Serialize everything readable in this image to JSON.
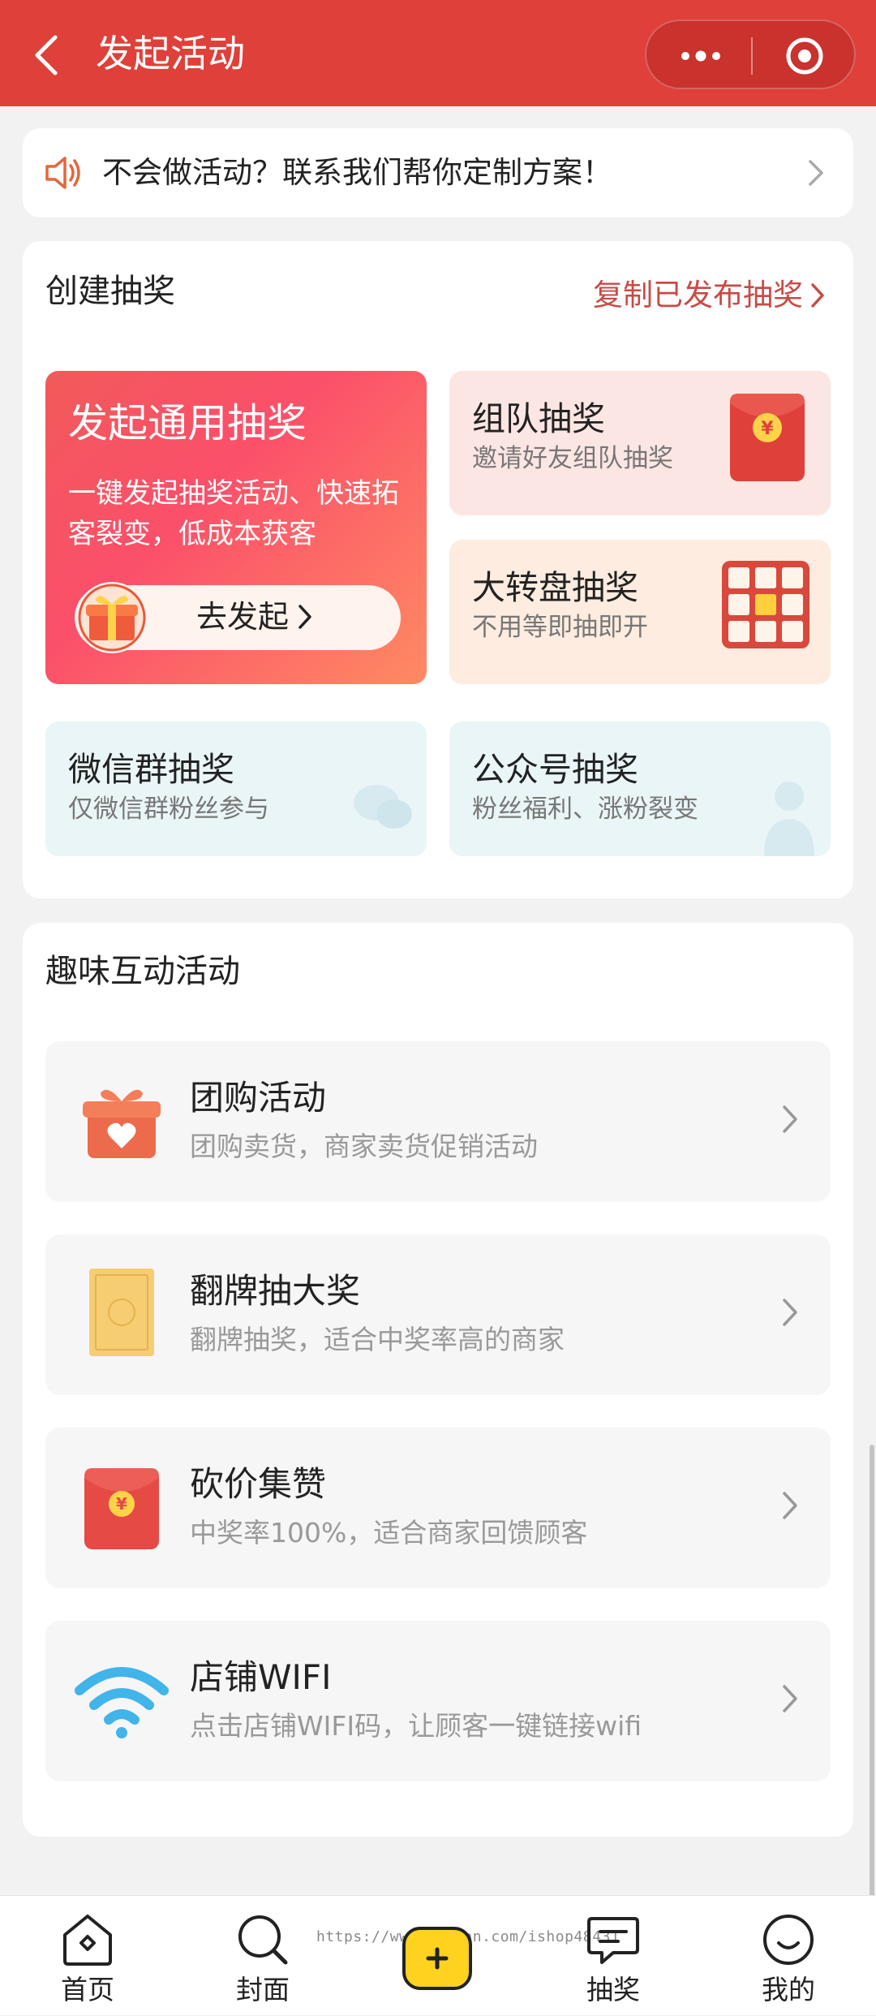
{
  "nav": {
    "title": "发起活动"
  },
  "notice": {
    "text": "不会做活动？联系我们帮你定制方案！"
  },
  "create": {
    "section_title": "创建抽奖",
    "copy_link": "复制已发布抽奖",
    "main_tile": {
      "title": "发起通用抽奖",
      "desc": "一键发起抽奖活动、快速拓客裂变，低成本获客",
      "button": "去发起"
    },
    "tiles": [
      {
        "title": "组队抽奖",
        "sub": "邀请好友组队抽奖"
      },
      {
        "title": "大转盘抽奖",
        "sub": "不用等即抽即开"
      },
      {
        "title": "微信群抽奖",
        "sub": "仅微信群粉丝参与"
      },
      {
        "title": "公众号抽奖",
        "sub": "粉丝福利、涨粉裂变"
      }
    ]
  },
  "fun": {
    "section_title": "趣味互动活动",
    "items": [
      {
        "title": "团购活动",
        "sub": "团购卖货，商家卖货促销活动",
        "icon": "gift-box-icon"
      },
      {
        "title": "翻牌抽大奖",
        "sub": "翻牌抽奖，适合中奖率高的商家",
        "icon": "card-icon"
      },
      {
        "title": "砍价集赞",
        "sub": "中奖率100%，适合商家回馈顾客",
        "icon": "red-envelope-icon"
      },
      {
        "title": "店铺WIFI",
        "sub": "点击店铺WIFI码，让顾客一键链接wifi",
        "icon": "wifi-icon"
      }
    ]
  },
  "tabbar": {
    "items": [
      {
        "label": "首页"
      },
      {
        "label": "封面"
      },
      {
        "label": "抽奖"
      },
      {
        "label": "我的"
      }
    ],
    "watermark": "https://www.huzhan.com/ishop48431"
  },
  "colors": {
    "brand_red": "#e0403a",
    "accent_yellow": "#ffd21f"
  }
}
